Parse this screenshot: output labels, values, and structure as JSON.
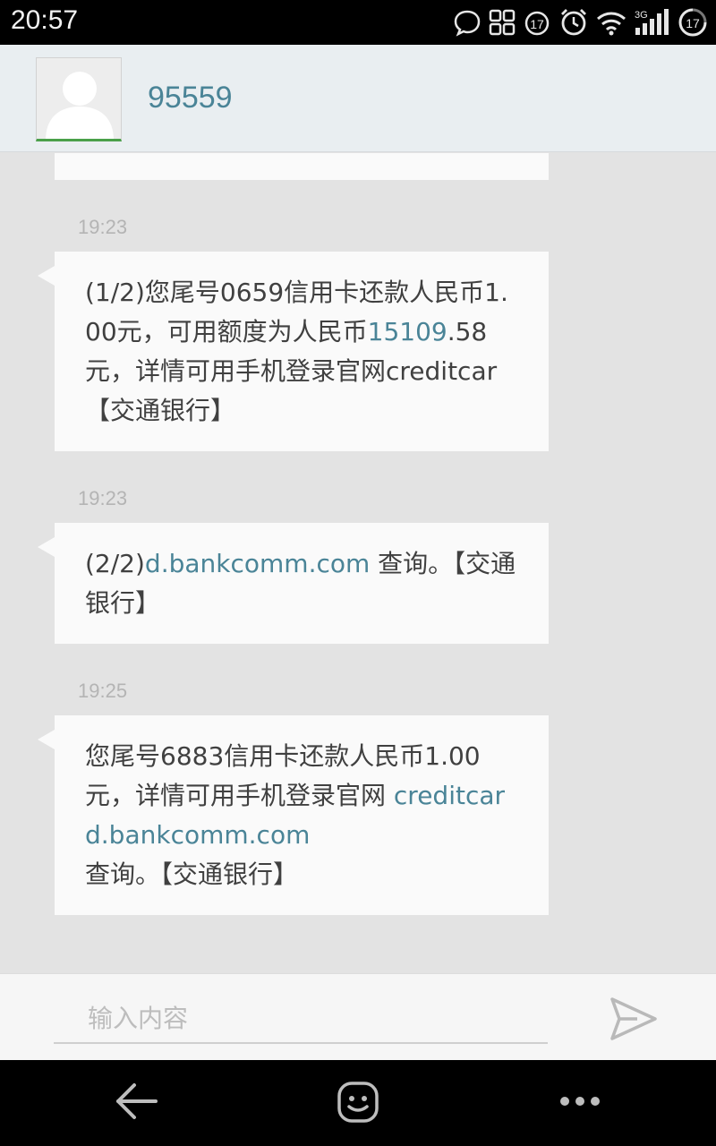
{
  "status_bar": {
    "time": "20:57",
    "icons": [
      "chat-bubble-icon",
      "apps-grid-icon",
      "badge-17-icon",
      "alarm-icon",
      "wifi-icon",
      "signal-3g-icon",
      "battery-17-icon"
    ],
    "network": "3G",
    "badge": "17",
    "battery": "17"
  },
  "header": {
    "contact_name": "95559",
    "avatar_icon": "default-avatar-icon"
  },
  "messages": [
    {
      "time": "19:23",
      "segments": [
        {
          "text": "(1/2)您尾号0659信用卡还款人民币1.00元，可用额度为人民币",
          "link": false
        },
        {
          "text": "15109",
          "link": true
        },
        {
          "text": ".58元，详情可用手机登录官网creditcar【交通银行】",
          "link": false
        }
      ]
    },
    {
      "time": "19:23",
      "segments": [
        {
          "text": "(2/2)",
          "link": false
        },
        {
          "text": "d.bankcomm.com",
          "link": true
        },
        {
          "text": " 查询。【交通银行】",
          "link": false
        }
      ]
    },
    {
      "time": "19:25",
      "segments": [
        {
          "text": "您尾号6883信用卡还款人民币1.00元，详情可用手机登录官网 ",
          "link": false
        },
        {
          "text": "creditcard.bankcomm.com",
          "link": true
        },
        {
          "text": " 查询。【交通银行】",
          "link": false
        }
      ]
    }
  ],
  "input": {
    "placeholder": "输入内容",
    "send_icon": "send-icon"
  },
  "nav_bar": {
    "back_icon": "back-arrow-icon",
    "emoji_icon": "emoji-icon",
    "more_icon": "more-icon"
  },
  "colors": {
    "link": "#4a8497",
    "bubble": "#fafafa",
    "background": "#e3e3e3",
    "header": "#e9eef1"
  }
}
